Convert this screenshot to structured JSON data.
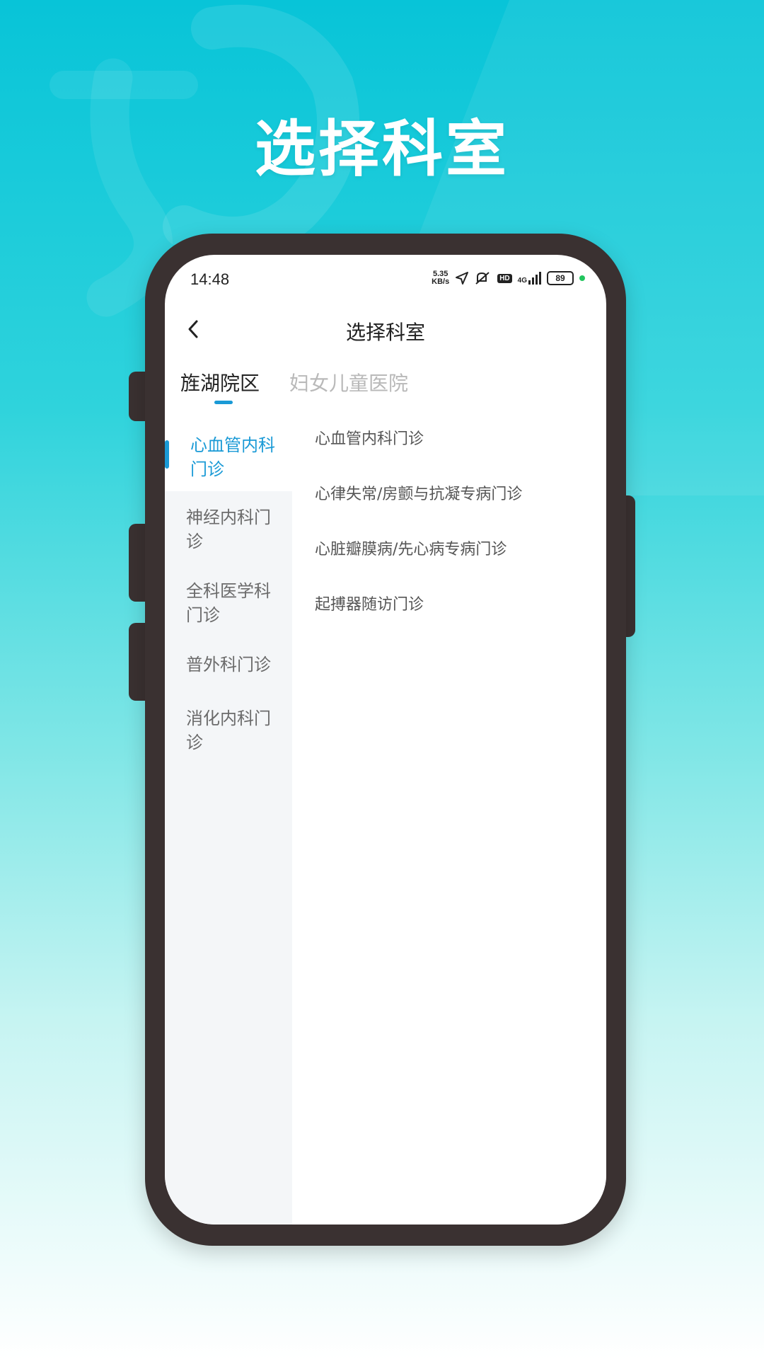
{
  "hero": {
    "title": "选择科室"
  },
  "status_bar": {
    "time": "14:48",
    "net_speed_value": "5.35",
    "net_speed_unit": "KB/s",
    "hd_label": "HD",
    "signal_label": "4G",
    "battery": "89",
    "icons": [
      "location-arrow-icon",
      "mute-icon",
      "hd-icon",
      "signal-icon",
      "battery-icon"
    ]
  },
  "nav": {
    "title": "选择科室",
    "back_icon": "chevron-left-icon"
  },
  "tabs": [
    {
      "label": "旌湖院区",
      "active": true
    },
    {
      "label": "妇女儿童医院",
      "active": false
    }
  ],
  "sidebar": {
    "items": [
      {
        "label": "心血管内科门诊",
        "active": true
      },
      {
        "label": "神经内科门诊",
        "active": false
      },
      {
        "label": "全科医学科门诊",
        "active": false
      },
      {
        "label": "普外科门诊",
        "active": false
      },
      {
        "label": "消化内科门诊",
        "active": false
      }
    ]
  },
  "departments": [
    {
      "label": "心血管内科门诊"
    },
    {
      "label": "心律失常/房颤与抗凝专病门诊"
    },
    {
      "label": "心脏瓣膜病/先心病专病门诊"
    },
    {
      "label": "起搏器随访门诊"
    }
  ],
  "colors": {
    "accent": "#1a9ad6",
    "phone_frame": "#3a3131",
    "background_top": "#08c4d8"
  }
}
